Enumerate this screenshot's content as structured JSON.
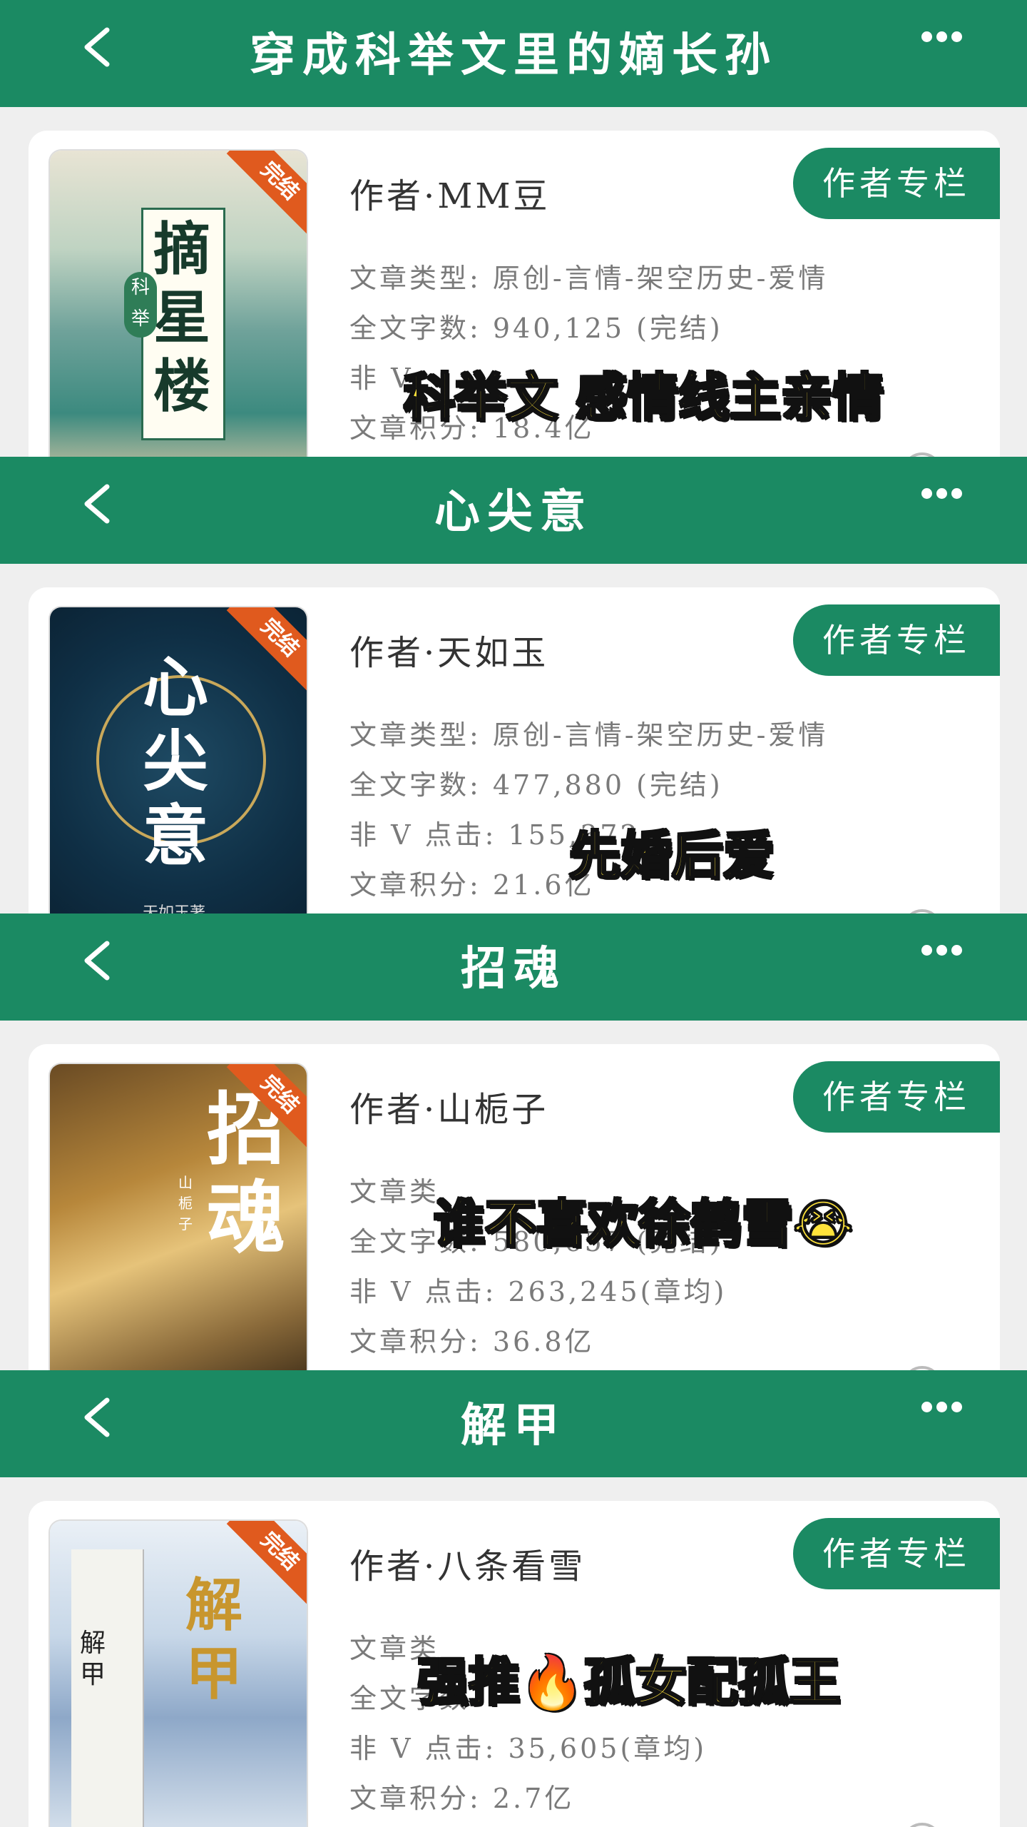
{
  "colors": {
    "accent": "#1b8a63",
    "ribbon": "#e05a1e",
    "subtitle": "#ffe33b"
  },
  "common": {
    "author_column": "作者专栏",
    "complete": "完结"
  },
  "panels": [
    {
      "title": "穿成科举文里的嫡长孙",
      "author": "作者·MM豆",
      "cover_text": "摘星楼",
      "cover_small": "科举",
      "meta": [
        "文章类型: 原创-言情-架空历史-爱情",
        "全文字数: 940,125 (完结)",
        "非 V",
        "文章积分: 18.4亿"
      ],
      "subtitle": "科举文 感情线主亲情"
    },
    {
      "title": "心尖意",
      "author": "作者·天如玉",
      "cover_text": "心尖意",
      "cover_small": "天如玉著",
      "meta": [
        "文章类型: 原创-言情-架空历史-爱情",
        "全文字数: 477,880 (完结)",
        "非 V 点击: 155,372",
        "文章积分: 21.6亿"
      ],
      "subtitle": "先婚后爱"
    },
    {
      "title": "招魂",
      "author": "作者·山栀子",
      "cover_text": "招魂",
      "cover_small": "山栀子",
      "meta": [
        "文章类",
        "全文字数: 580,657 (完结)",
        "非 V 点击: 263,245(章均)",
        "文章积分: 36.8亿"
      ],
      "subtitle": "谁不喜欢徐鹤雪😭"
    },
    {
      "title": "解甲",
      "author": "作者·八条看雪",
      "cover_text": "解甲",
      "cover_small": "解甲",
      "meta": [
        "文章类",
        "全文字数",
        "非 V 点击: 35,605(章均)",
        "文章积分: 2.7亿"
      ],
      "subtitle": "强推🔥孤女配孤王"
    }
  ]
}
